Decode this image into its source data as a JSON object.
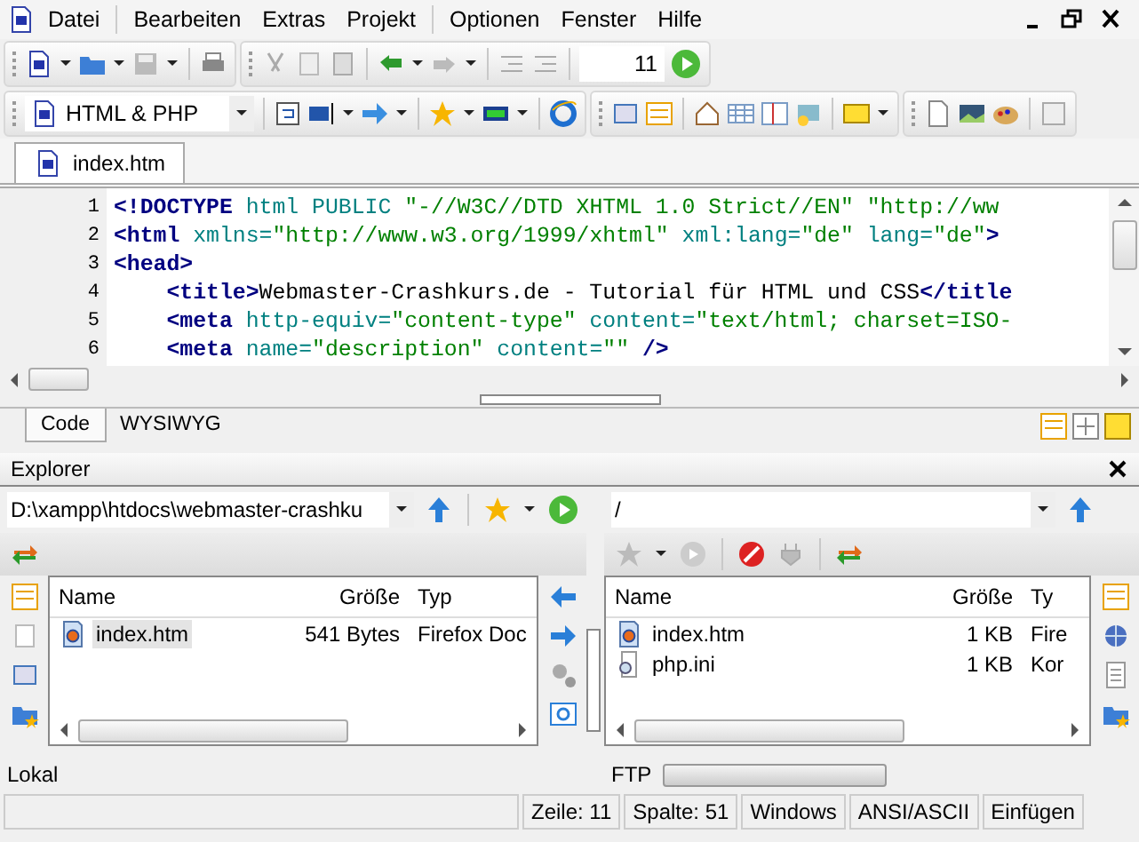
{
  "menu_bar": {
    "items": [
      "Datei",
      "Bearbeiten",
      "Extras",
      "Projekt",
      "Optionen",
      "Fenster",
      "Hilfe"
    ]
  },
  "toolbar": {
    "line_field": "11"
  },
  "format_toolbar": {
    "language": "HTML & PHP"
  },
  "document_tabs": [
    {
      "label": "index.htm",
      "selected": true
    }
  ],
  "editor": {
    "lines": [
      {
        "number": "1",
        "segments": [
          {
            "kind": "tag",
            "text": "<!DOCTYPE"
          },
          {
            "kind": "attr",
            "text": " html PUBLIC "
          },
          {
            "kind": "value",
            "text": "\"-//W3C//DTD XHTML 1.0 Strict//EN\" \"http://ww"
          }
        ]
      },
      {
        "number": "2",
        "segments": [
          {
            "kind": "tag",
            "text": "<html"
          },
          {
            "kind": "attr",
            "text": " xmlns="
          },
          {
            "kind": "value",
            "text": "\"http://www.w3.org/1999/xhtml\""
          },
          {
            "kind": "attr",
            "text": " xml:lang="
          },
          {
            "kind": "value",
            "text": "\"de\""
          },
          {
            "kind": "attr",
            "text": " lang="
          },
          {
            "kind": "value",
            "text": "\"de\""
          },
          {
            "kind": "tag",
            "text": ">"
          }
        ]
      },
      {
        "number": "3",
        "segments": [
          {
            "kind": "tag",
            "text": "<head>"
          }
        ]
      },
      {
        "number": "4",
        "segments": [
          {
            "kind": "tag",
            "text": "    <title>"
          },
          {
            "kind": "text",
            "text": "Webmaster-Crashkurs.de - Tutorial für HTML und CSS"
          },
          {
            "kind": "tag",
            "text": "</title"
          }
        ]
      },
      {
        "number": "5",
        "segments": [
          {
            "kind": "tag",
            "text": "    <meta"
          },
          {
            "kind": "attr",
            "text": " http-equiv="
          },
          {
            "kind": "value",
            "text": "\"content-type\""
          },
          {
            "kind": "attr",
            "text": " content="
          },
          {
            "kind": "value",
            "text": "\"text/html; charset=ISO-"
          }
        ]
      },
      {
        "number": "6",
        "segments": [
          {
            "kind": "tag",
            "text": "    <meta"
          },
          {
            "kind": "attr",
            "text": " name="
          },
          {
            "kind": "value",
            "text": "\"description\""
          },
          {
            "kind": "attr",
            "text": " content="
          },
          {
            "kind": "value",
            "text": "\"\""
          },
          {
            "kind": "tag",
            "text": " />"
          }
        ]
      }
    ]
  },
  "view_tabs": [
    {
      "label": "Code",
      "selected": true
    },
    {
      "label": "WYSIWYG",
      "selected": false
    }
  ],
  "explorer": {
    "title": "Explorer",
    "local": {
      "path": "D:\\xampp\\htdocs\\webmaster-crashku",
      "columns": [
        "Name",
        "Größe",
        "Typ"
      ],
      "rows": [
        {
          "name": "index.htm",
          "size": "541 Bytes",
          "type": "Firefox Doc",
          "kind": "document",
          "selected": true
        }
      ],
      "label": "Lokal"
    },
    "remote": {
      "path": "/",
      "columns": [
        "Name",
        "Größe",
        "Ty"
      ],
      "rows": [
        {
          "name": "index.htm",
          "size": "1 KB",
          "type": "Fire",
          "kind": "document",
          "selected": false
        },
        {
          "name": "php.ini",
          "size": "1 KB",
          "type": "Kor",
          "kind": "config",
          "selected": false
        }
      ],
      "label": "FTP",
      "progress": {
        "level": 0
      }
    }
  },
  "status_bar": {
    "fields": [
      "Zeile: 11",
      "Spalte: 51",
      "Windows",
      "ANSI/ASCII",
      "Einfügen"
    ]
  }
}
